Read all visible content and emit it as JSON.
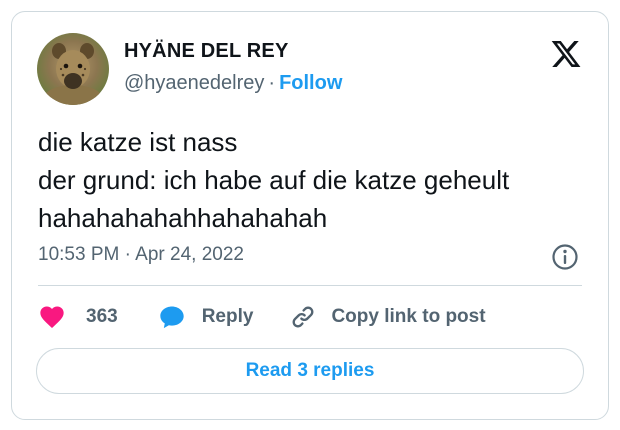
{
  "author": {
    "display_name": "HYÄNE DEL REY",
    "handle": "@hyaenedelrey",
    "separator": "·",
    "follow_label": "Follow",
    "avatar_icon": "hyena-avatar"
  },
  "platform": {
    "logo_icon": "x-logo-icon"
  },
  "tweet": {
    "lines": [
      "die katze ist nass",
      "der grund: ich habe auf die katze geheult",
      "hahahahahahhahahahah"
    ],
    "timestamp": "10:53 PM · Apr 24, 2022"
  },
  "actions": {
    "like": {
      "count": "363",
      "icon": "heart-icon",
      "color": "#f91880"
    },
    "reply": {
      "label": "Reply",
      "icon": "speech-bubble-icon",
      "color": "#1d9bf0"
    },
    "copy_link": {
      "label": "Copy link to post",
      "icon": "link-icon"
    }
  },
  "read_replies": {
    "label": "Read 3 replies"
  },
  "colors": {
    "accent": "#1d9bf0",
    "text": "#0f1419",
    "muted": "#536471",
    "border": "#cfd9de"
  }
}
